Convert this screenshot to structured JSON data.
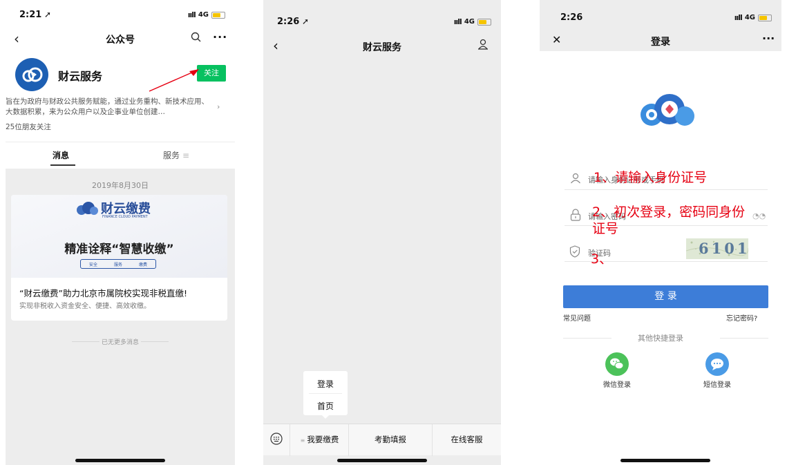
{
  "status": {
    "p1_time": "2:21",
    "p2_time": "2:26",
    "p3_time": "2:26",
    "network": "4G",
    "signal": "ııll"
  },
  "p1": {
    "title": "公众号",
    "account_name": "财云服务",
    "follow_label": "关注",
    "desc": "旨在为政府与财政公共服务赋能，通过业务重构、新技术应用、大数据积累，来为公众用户以及企事业单位创建…",
    "followers": "25位朋友关注",
    "tabs": [
      "消息",
      "服务"
    ],
    "date": "2019年8月30日",
    "card": {
      "brand": "财云缴费",
      "brand_en": "FINANCE CLOUD PAYMENT",
      "slogan": "精准诠释“智慧收缴”",
      "badges": [
        "安全",
        "服务",
        "缴费"
      ],
      "headline": "“财云缴费”助力北京市属院校实现非税直缴!",
      "sub": "实现非税收入资金安全、便捷、高效收缴。"
    },
    "no_more": "已无更多消息"
  },
  "p2": {
    "title": "财云服务",
    "popup": [
      "登录",
      "首页"
    ],
    "menu": [
      "我要缴费",
      "考勤填报",
      "在线客服"
    ]
  },
  "p3": {
    "title": "登录",
    "id_placeholder": "请输入身份证号或手机",
    "pwd_placeholder": "请输入密码",
    "captcha_placeholder": "验证码",
    "captcha_code": "6101",
    "login_button": "登 录",
    "faq": "常见问题",
    "forgot": "忘记密码?",
    "other_login": "其他快捷登录",
    "wechat_login": "微信登录",
    "sms_login": "短信登录",
    "notes": {
      "n1": "1、请输入身份证号",
      "n2a": "2、初次登录，密码同身份",
      "n2b": "证号",
      "n3": "3、"
    }
  },
  "colors": {
    "wechat_green": "#07c160",
    "brand_blue": "#1d5fb3",
    "login_blue": "#3d7dd8",
    "note_red": "#e60012"
  }
}
